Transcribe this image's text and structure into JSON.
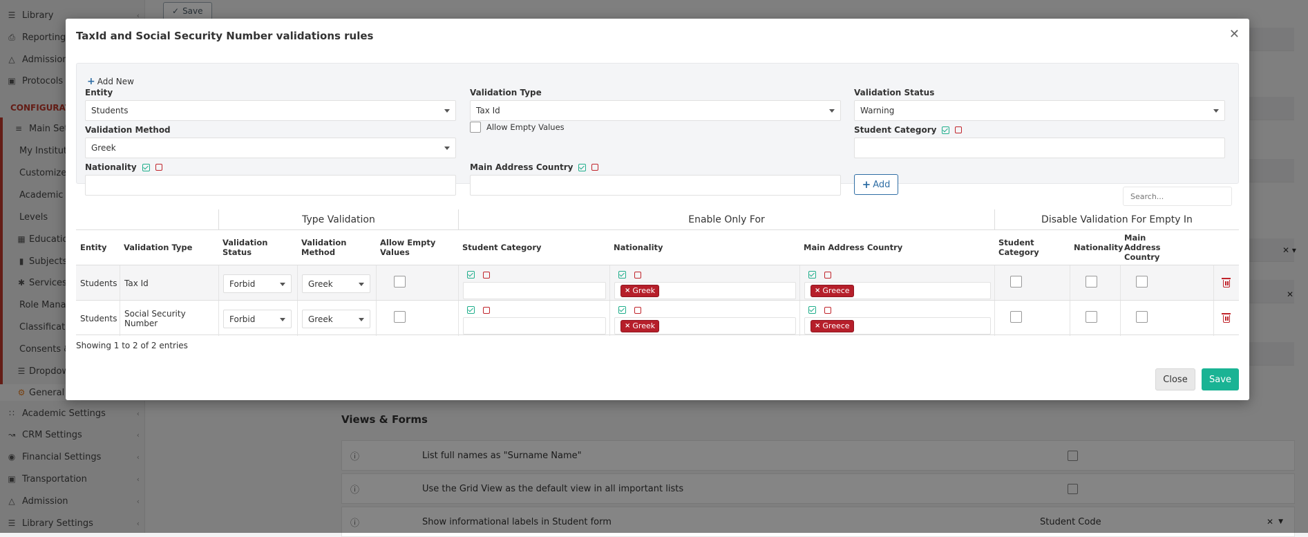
{
  "sidebar": {
    "items": [
      {
        "label": "Library",
        "icon": "books-icon"
      },
      {
        "label": "Reporting",
        "icon": "printer-icon"
      },
      {
        "label": "Admission",
        "icon": "bank-icon"
      },
      {
        "label": "Protocols",
        "icon": "folder-icon"
      }
    ],
    "config_heading": "CONFIGURATI",
    "main_settings": "Main Settin",
    "sub_items": [
      "My Institute",
      "Customize T",
      "Academic P",
      "Levels",
      "Educatio",
      "Subjects",
      "Services",
      "Role Manag",
      "Classificati",
      "Consents &",
      "Dropdow",
      "General"
    ],
    "lower_items": [
      {
        "label": "Academic Settings",
        "icon": "grid-icon"
      },
      {
        "label": "CRM Settings",
        "icon": "chart-icon"
      },
      {
        "label": "Financial Settings",
        "icon": "coins-icon"
      },
      {
        "label": "Transportation",
        "icon": "bus-icon"
      },
      {
        "label": "Admission",
        "icon": "bank-icon"
      },
      {
        "label": "Library Settings",
        "icon": "books-icon"
      }
    ]
  },
  "background": {
    "top_save_label": "Save",
    "section_title": "Views & Forms",
    "rows": [
      {
        "text": "List full names as \"Surname Name\"",
        "control": "checkbox"
      },
      {
        "text": "Use the Grid View as the default view in all important lists",
        "control": "checkbox"
      },
      {
        "text": "Show informational labels in Student form",
        "control": "select",
        "value": "Student Code"
      }
    ]
  },
  "modal": {
    "title": "TaxId and Social Security Number validations rules",
    "add_new_label": "Add New",
    "form": {
      "entity_label": "Entity",
      "entity_value": "Students",
      "validation_type_label": "Validation Type",
      "validation_type_value": "Tax Id",
      "validation_status_label": "Validation Status",
      "validation_status_value": "Warning",
      "validation_method_label": "Validation Method",
      "validation_method_value": "Greek",
      "allow_empty_label": "Allow Empty Values",
      "student_category_label": "Student Category",
      "nationality_label": "Nationality",
      "main_address_country_label": "Main Address Country",
      "add_button_label": "Add"
    },
    "search_placeholder": "Search...",
    "table": {
      "groups": {
        "type_validation": "Type Validation",
        "enable_only_for": "Enable Only For",
        "disable_validation": "Disable Validation For Empty In"
      },
      "headers": [
        "Entity",
        "Validation Type",
        "Validation Status",
        "Validation Method",
        "Allow Empty Values",
        "Student Category",
        "Nationality",
        "Main Address Country",
        "Student Category",
        "Nationality",
        "Main Address Country"
      ],
      "rows": [
        {
          "entity": "Students",
          "validation_type": "Tax Id",
          "validation_status": "Forbid",
          "validation_method": "Greek",
          "nationality_tag": "Greek",
          "country_tag": "Greece"
        },
        {
          "entity": "Students",
          "validation_type": "Social Security Number",
          "validation_status": "Forbid",
          "validation_method": "Greek",
          "nationality_tag": "Greek",
          "country_tag": "Greece"
        }
      ]
    },
    "showing_text": "Showing 1 to 2 of 2 entries",
    "close_label": "Close",
    "save_label": "Save"
  },
  "colors": {
    "accent_teal": "#1ab394",
    "accent_blue": "#2e6da4",
    "tag_red": "#b61f2a",
    "config_red": "#c0392b"
  }
}
